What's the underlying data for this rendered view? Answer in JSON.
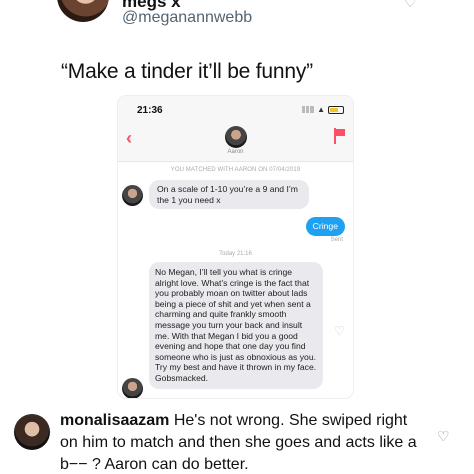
{
  "tweet": {
    "display_name": "megs x",
    "handle": "@meganannwebb",
    "text": "“Make a tinder it’ll be funny”"
  },
  "phone": {
    "status_time": "21:36",
    "match_name": "Aaron",
    "matched_line": "YOU MATCHED WITH AARON ON 07/04/2019",
    "messages": [
      {
        "from": "Aaron",
        "text": "On a scale of 1-10 you’re a 9 and I’m the 1 you need x"
      },
      {
        "from": "me",
        "text": "Cringe",
        "status": "Sent"
      },
      {
        "from": "Aaron",
        "text": "No Megan, I’ll tell you what is cringe alright love.  What’s cringe is the fact that you probably moan on twitter about lads being a piece of shit and yet when sent a charming and quite frankly smooth message you turn your back and insult me. With that Megan I bid you a good evening and hope that one day you find someone who is just as obnoxious as you. Try my best and have it thrown in my face. Gobsmacked."
      }
    ],
    "today_label": "Today  21:16"
  },
  "reply": {
    "username": "monalisaazam",
    "text": "He's not wrong. She swiped right on him to match and then she goes and acts like a b−− ? Aaron can do better."
  },
  "colors": {
    "tinder_accent": "#fd5068",
    "sent_bubble": "#1fa1f1",
    "received_bubble": "#e9e9ee"
  }
}
